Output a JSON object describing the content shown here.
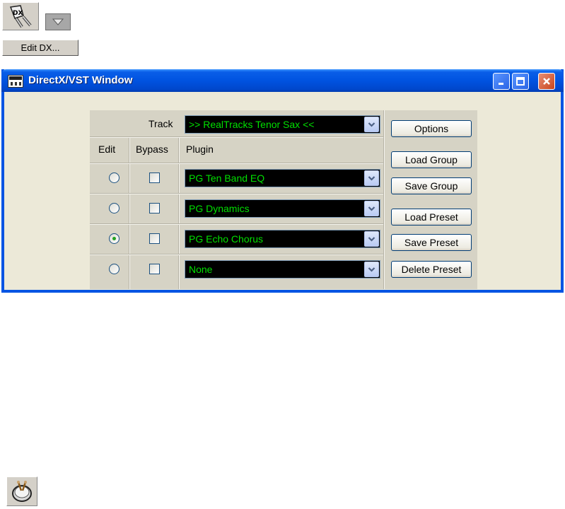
{
  "toolbar": {
    "dx_icon": "dx-plugin-icon",
    "dropdown_icon": "triangle-down-icon",
    "edit_dx_label": "Edit DX..."
  },
  "window": {
    "title": "DirectX/VST Window",
    "colors": {
      "titlebar": "#0054e3",
      "combo_bg": "#000000",
      "combo_text": "#00e000"
    }
  },
  "panel": {
    "track_label": "Track",
    "track_value": ">> RealTracks Tenor Sax <<",
    "headers": {
      "edit": "Edit",
      "bypass": "Bypass",
      "plugin": "Plugin"
    },
    "rows": [
      {
        "plugin": "PG Ten Band EQ",
        "edit_selected": false,
        "bypass": false
      },
      {
        "plugin": "PG Dynamics",
        "edit_selected": false,
        "bypass": false
      },
      {
        "plugin": "PG Echo Chorus",
        "edit_selected": true,
        "bypass": false
      },
      {
        "plugin": "None",
        "edit_selected": false,
        "bypass": false
      }
    ]
  },
  "buttons": {
    "options": "Options",
    "load_group": "Load Group",
    "save_group": "Save Group",
    "load_preset": "Load Preset",
    "save_preset": "Save Preset",
    "delete_preset": "Delete Preset"
  },
  "bottom": {
    "drum_icon": "drum-icon"
  }
}
